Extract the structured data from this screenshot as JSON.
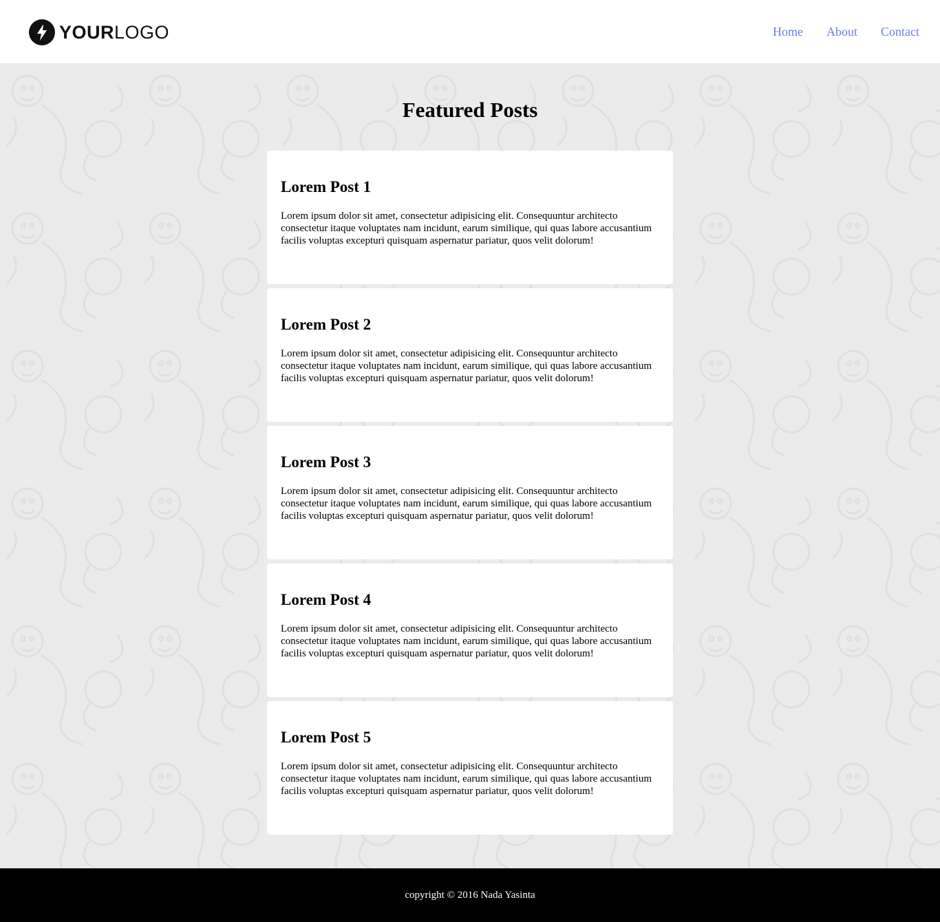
{
  "header": {
    "logo": {
      "bold": "YOUR",
      "light": "LOGO",
      "icon": "lightning-bolt-icon"
    },
    "nav": [
      {
        "label": "Home"
      },
      {
        "label": "About"
      },
      {
        "label": "Contact"
      }
    ]
  },
  "main": {
    "title": "Featured Posts",
    "posts": [
      {
        "title": "Lorem Post 1",
        "body": "Lorem ipsum dolor sit amet, consectetur adipisicing elit. Consequuntur architecto consectetur itaque voluptates nam incidunt, earum similique, qui quas labore accusantium facilis voluptas excepturi quisquam aspernatur pariatur, quos velit dolorum!"
      },
      {
        "title": "Lorem Post 2",
        "body": "Lorem ipsum dolor sit amet, consectetur adipisicing elit. Consequuntur architecto consectetur itaque voluptates nam incidunt, earum similique, qui quas labore accusantium facilis voluptas excepturi quisquam aspernatur pariatur, quos velit dolorum!"
      },
      {
        "title": "Lorem Post 3",
        "body": "Lorem ipsum dolor sit amet, consectetur adipisicing elit. Consequuntur architecto consectetur itaque voluptates nam incidunt, earum similique, qui quas labore accusantium facilis voluptas excepturi quisquam aspernatur pariatur, quos velit dolorum!"
      },
      {
        "title": "Lorem Post 4",
        "body": "Lorem ipsum dolor sit amet, consectetur adipisicing elit. Consequuntur architecto consectetur itaque voluptates nam incidunt, earum similique, qui quas labore accusantium facilis voluptas excepturi quisquam aspernatur pariatur, quos velit dolorum!"
      },
      {
        "title": "Lorem Post 5",
        "body": "Lorem ipsum dolor sit amet, consectetur adipisicing elit. Consequuntur architecto consectetur itaque voluptates nam incidunt, earum similique, qui quas labore accusantium facilis voluptas excepturi quisquam aspernatur pariatur, quos velit dolorum!"
      }
    ]
  },
  "footer": {
    "text": "copyright © 2016 Nada Yasinta"
  },
  "colors": {
    "nav_link": "#6c7fd8",
    "page_bg": "#ebebeb",
    "card_bg": "#ffffff",
    "footer_bg": "#000000"
  }
}
